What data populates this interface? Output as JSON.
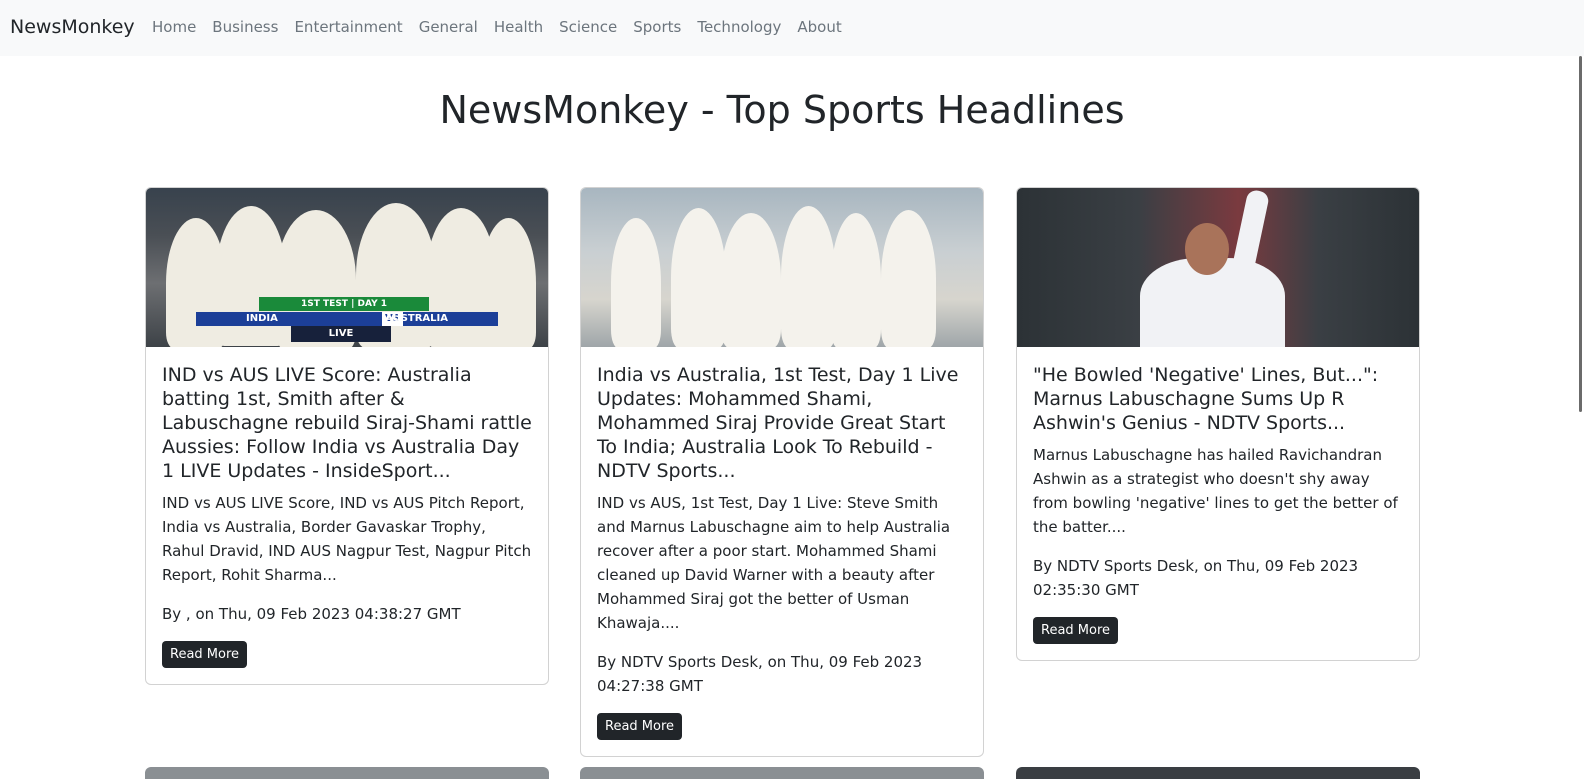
{
  "navbar": {
    "brand": "NewsMonkey",
    "links": [
      "Home",
      "Business",
      "Entertainment",
      "General",
      "Health",
      "Science",
      "Sports",
      "Technology",
      "About"
    ]
  },
  "page": {
    "title": "NewsMonkey - Top Sports Headlines"
  },
  "cards": [
    {
      "image_alt": "India team huddle",
      "image_banner_top": "1ST TEST | DAY 1",
      "image_banner_left": "INDIA",
      "image_banner_vs": "VS",
      "image_banner_right": "AUSTRALIA",
      "image_banner_bottom": "LIVE",
      "title": "IND vs AUS LIVE Score: Australia batting 1st, Smith after & Labuschagne rebuild Siraj-Shami rattle Aussies: Follow India vs Australia Day 1 LIVE Updates - InsideSport...",
      "description": "IND vs AUS LIVE Score, IND vs AUS Pitch Report, India vs Australia, Border Gavaskar Trophy, Rahul Dravid, IND AUS Nagpur Test, Nagpur Pitch Report, Rohit Sharma...",
      "meta": "By , on Thu, 09 Feb 2023 04:38:27 GMT",
      "button": "Read More"
    },
    {
      "image_alt": "India players celebrating",
      "title": "India vs Australia, 1st Test, Day 1 Live Updates: Mohammed Shami, Mohammed Siraj Provide Great Start To India; Australia Look To Rebuild - NDTV Sports...",
      "description": "IND vs AUS, 1st Test, Day 1 Live: Steve Smith and Marnus Labuschagne aim to help Australia recover after a poor start. Mohammed Shami cleaned up David Warner with a beauty after Mohammed Siraj got the better of Usman Khawaja....",
      "meta": "By NDTV Sports Desk, on Thu, 09 Feb 2023 04:27:38 GMT",
      "button": "Read More"
    },
    {
      "image_alt": "R Ashwin bowling",
      "title": "\"He Bowled 'Negative' Lines, But...\": Marnus Labuschagne Sums Up R Ashwin's Genius - NDTV Sports...",
      "description": "Marnus Labuschagne has hailed Ravichandran Ashwin as a strategist who doesn't shy away from bowling 'negative' lines to get the better of the batter....",
      "meta": "By NDTV Sports Desk, on Thu, 09 Feb 2023 02:35:30 GMT",
      "button": "Read More"
    }
  ]
}
